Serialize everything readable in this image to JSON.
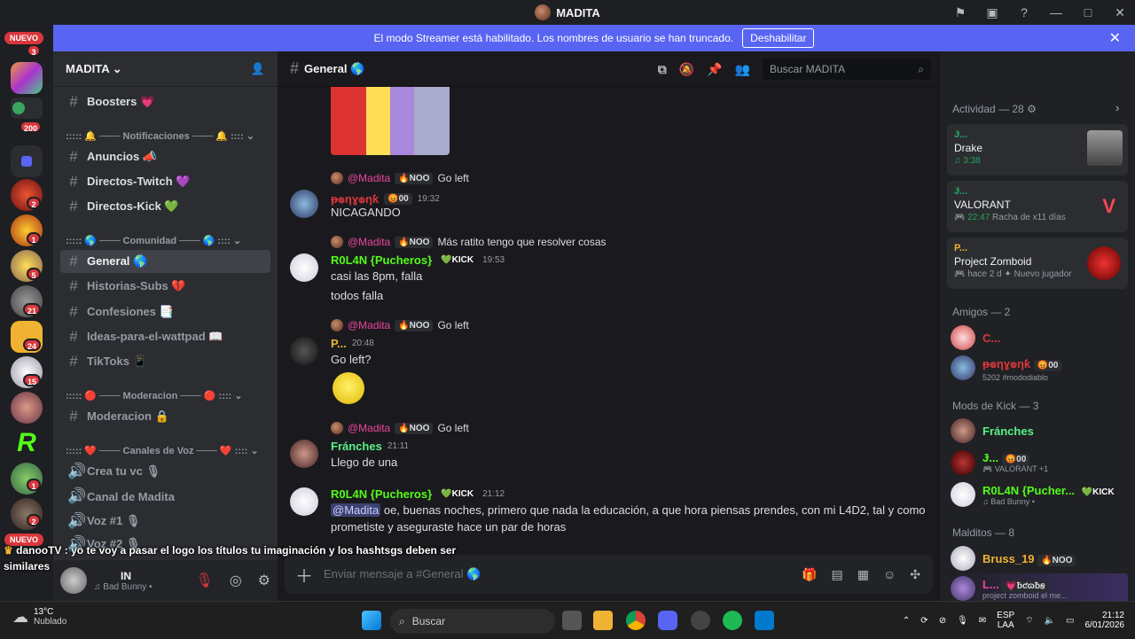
{
  "window": {
    "title": "MADITA"
  },
  "banner": {
    "text": "El modo Streamer está habilitado. Los nombres de usuario se han truncado.",
    "button": "Deshabilitar"
  },
  "servers": {
    "nuevo_top": "NUEVO",
    "nuevo_bottom": "NUEVO",
    "badges": [
      "3",
      "200",
      "2",
      "1",
      "5",
      "21",
      "24",
      "15",
      "1",
      "2"
    ]
  },
  "guild": {
    "name": "MADITA"
  },
  "channels": {
    "boosters": "Boosters 💗",
    "cat_notif": "::::: 🔔 ─── Notificaciones ─── 🔔 :::: ⌄",
    "anuncios": "Anuncios 📣",
    "twitch": "Directos-Twitch 💜",
    "kick": "Directos-Kick 💚",
    "cat_comunidad": "::::: 🌎 ─── Comunidad ─── 🌎 :::: ⌄",
    "general": "General 🌎",
    "historias": "Historias-Subs 💔",
    "confesiones": "Confesiones 📑",
    "ideas": "Ideas-para-el-wattpad 📖",
    "tiktoks": "TikToks 📱",
    "cat_moderacion": "::::: 🔴 ─── Moderacion ─── 🔴 :::: ⌄",
    "moderacion": "Moderacion 🔒",
    "cat_voz": "::::: ❤️ ─── Canales de Voz ─── ❤️ :::: ⌄",
    "crea": "Crea tu vc 🎙",
    "canal_madita": "Canal de Madita",
    "voz1": "Voz #1 🎙",
    "voz2": "Voz #2 🎙"
  },
  "user_panel": {
    "name": "IN",
    "status": "Bad Bunny •"
  },
  "chat": {
    "channel": "General 🌎",
    "search_placeholder": "Buscar MADITA",
    "composer_placeholder": "Enviar mensaje a #General 🌎",
    "messages": [
      {
        "reply_to": "@Madita",
        "reply_tag": "🔥NOO",
        "reply_text": "Go left",
        "author": "ᵽ๏ƞɣ๏ƞƙ",
        "tag": "😡00",
        "time": "19:32",
        "lines": [
          "NICAGANDO"
        ]
      },
      {
        "reply_to": "@Madita",
        "reply_tag": "🔥NOO",
        "reply_text": "Más ratito tengo que resolver cosas",
        "author": "R0L4N {Pucheros}",
        "tag": "💚KICK",
        "time": "19:53",
        "lines": [
          "casi las 8pm, falla",
          "todos falla"
        ]
      },
      {
        "reply_to": "@Madita",
        "reply_tag": "🔥NOO",
        "reply_text": "Go left",
        "author": "P...",
        "tag": "",
        "time": "20:48",
        "lines": [
          "Go left?"
        ]
      },
      {
        "reply_to": "@Madita",
        "reply_tag": "🔥NOO",
        "reply_text": "Go left",
        "author": "Fránches",
        "tag": "",
        "time": "21:11",
        "lines": [
          "Llego de una"
        ]
      },
      {
        "reply_to": "",
        "reply_tag": "",
        "reply_text": "",
        "author": "R0L4N {Pucheros}",
        "tag": "💚KICK",
        "time": "21:12",
        "mention": "@Madita",
        "lines": [
          "oe, buenas noches, primero que nada la educación, a que hora piensas prendes, con mi L4D2, tal y como",
          "prometiste y aseguraste hace un par de horas"
        ]
      }
    ]
  },
  "overlay": {
    "user": "danooTV",
    "text": ": yo te voy a pasar el logo los títulos tu imaginación y los hashtsgs deben ser similares"
  },
  "members": {
    "activity_header": "Actividad — 28",
    "activities": [
      {
        "name": "Ɉ...",
        "title": "Drake",
        "detail": "3:38",
        "extra": ""
      },
      {
        "name": "Ɉ...",
        "title": "VALORANT",
        "detail": "22:47",
        "extra": "Racha de x11 días"
      },
      {
        "name": "P...",
        "title": "Project Zomboid",
        "detail": "hace 2 d",
        "extra": "Nuevo jugador"
      }
    ],
    "friends_header": "Amigos — 2",
    "friends": [
      {
        "name": "C...",
        "tag": "",
        "sub": ""
      },
      {
        "name": "ᵽ๏ƞɣ๏ƞƙ",
        "tag": "😡00",
        "sub": "5202 #mododiablo"
      }
    ],
    "mods_header": "Mods de Kick — 3",
    "mods": [
      {
        "name": "Fránches",
        "tag": "",
        "sub": ""
      },
      {
        "name": "Ɉ...",
        "tag": "😡00",
        "sub": "VALORANT +1"
      },
      {
        "name": "R0L4N {Pucher...",
        "tag": "💚KICK",
        "sub": "Bad Bunny •"
      }
    ],
    "cursed_header": "Malditos — 8",
    "cursed": [
      {
        "name": "Bruss_19",
        "tag": "🔥NOO",
        "sub": ""
      },
      {
        "name": "L...",
        "tag": "💗ƀƈɷƀꞩ",
        "sub": "project zomboid el me..."
      }
    ]
  },
  "taskbar": {
    "weather_temp": "13°C",
    "weather_text": "Nublado",
    "search": "Buscar",
    "lang": "ESP",
    "lang2": "LAA",
    "time": "21:12",
    "date": "6/01/2026"
  },
  "colors": {
    "accent": "#5865f2",
    "green": "#3ba55d",
    "kick_green": "#53fc18",
    "pink": "#eb459e",
    "red": "#da373c"
  }
}
